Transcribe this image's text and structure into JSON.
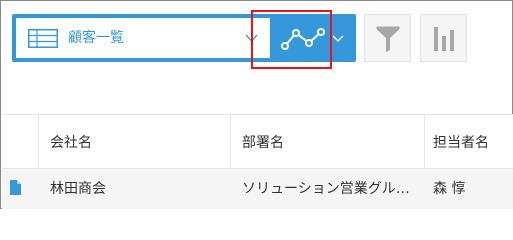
{
  "toolbar": {
    "view_select": {
      "label": "顧客一覧",
      "icon": "table-list-icon"
    },
    "graph_button": {
      "icon": "line-graph-icon",
      "highlighted": true
    },
    "filter_button": {
      "icon": "funnel-icon"
    },
    "chart_button": {
      "icon": "bar-chart-icon"
    },
    "colors": {
      "accent": "#3498db",
      "highlight": "#e8141c",
      "button_bg": "#f5f5f5",
      "icon_gray": "#a8a8a8"
    }
  },
  "table": {
    "columns": [
      "会社名",
      "部署名",
      "担当者名"
    ],
    "rows": [
      {
        "icon": "document-icon",
        "cells": [
          "林田商会",
          "ソリューション営業グル…",
          "森 惇"
        ]
      }
    ]
  }
}
